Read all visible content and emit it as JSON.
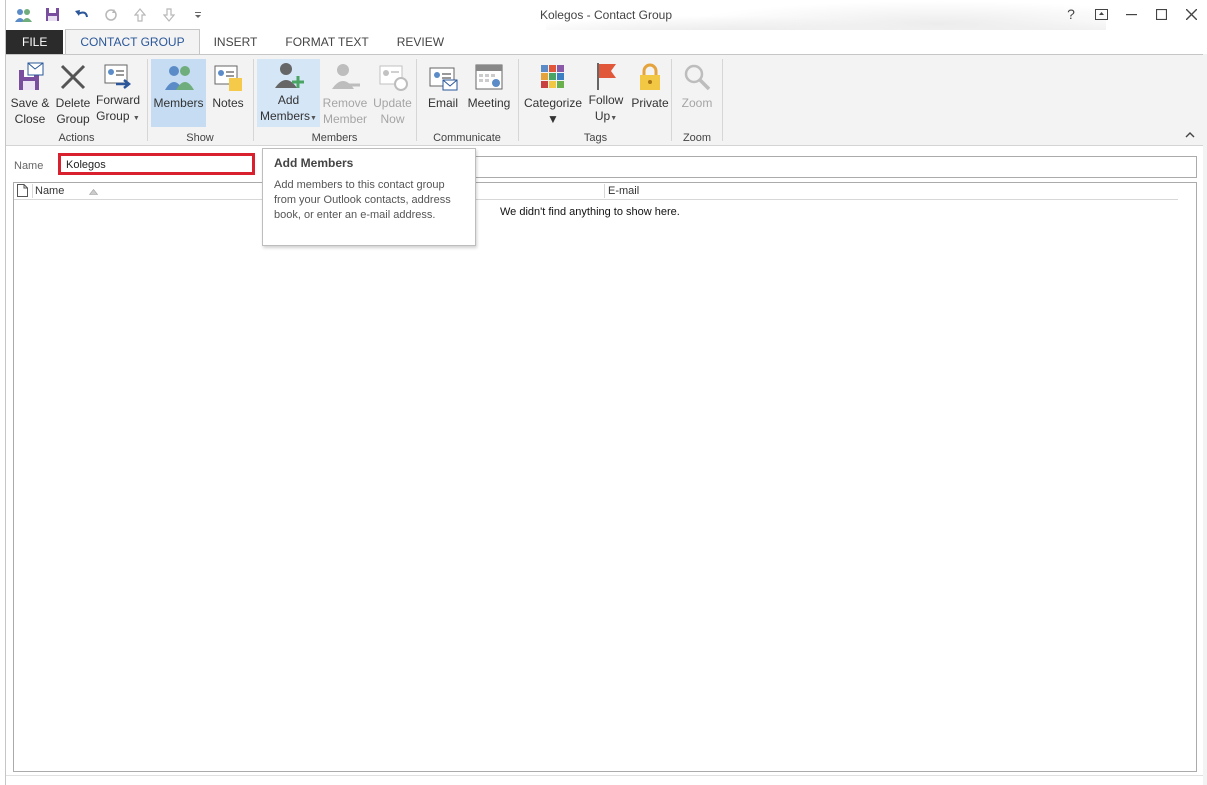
{
  "window": {
    "title": "Kolegos - Contact Group",
    "controls": {
      "help": "?",
      "ribbon_display": "⧉",
      "minimize": "–",
      "maximize": "☐",
      "close": "✕"
    }
  },
  "tabs": [
    {
      "label": "FILE"
    },
    {
      "label": "CONTACT GROUP"
    },
    {
      "label": "INSERT"
    },
    {
      "label": "FORMAT TEXT"
    },
    {
      "label": "REVIEW"
    }
  ],
  "ribbon": {
    "actions": {
      "label": "Actions",
      "save_close": [
        "Save &",
        "Close"
      ],
      "delete_group": [
        "Delete",
        "Group"
      ],
      "forward_group": [
        "Forward",
        "Group"
      ]
    },
    "show": {
      "label": "Show",
      "members": "Members",
      "notes": "Notes"
    },
    "members": {
      "label": "Members",
      "add_members": [
        "Add",
        "Members"
      ],
      "remove_member": [
        "Remove",
        "Member"
      ],
      "update_now": [
        "Update",
        "Now"
      ]
    },
    "communicate": {
      "label": "Communicate",
      "email": "Email",
      "meeting": "Meeting"
    },
    "tags": {
      "label": "Tags",
      "categorize": "Categorize",
      "follow_up": [
        "Follow",
        "Up"
      ],
      "private": "Private"
    },
    "zoom": {
      "label": "Zoom",
      "zoom": "Zoom"
    }
  },
  "name_field": {
    "label": "Name",
    "value": "Kolegos"
  },
  "list": {
    "columns": {
      "name": "Name",
      "email": "E-mail"
    },
    "empty_text": "We didn't find anything to show here."
  },
  "tooltip": {
    "title": "Add Members",
    "description": "Add members to this contact group from your Outlook contacts, address book, or enter an e-mail address."
  },
  "colors": {
    "accent": "#2b579a",
    "highlight": "#d9202e",
    "selected": "#c5dcf2"
  }
}
